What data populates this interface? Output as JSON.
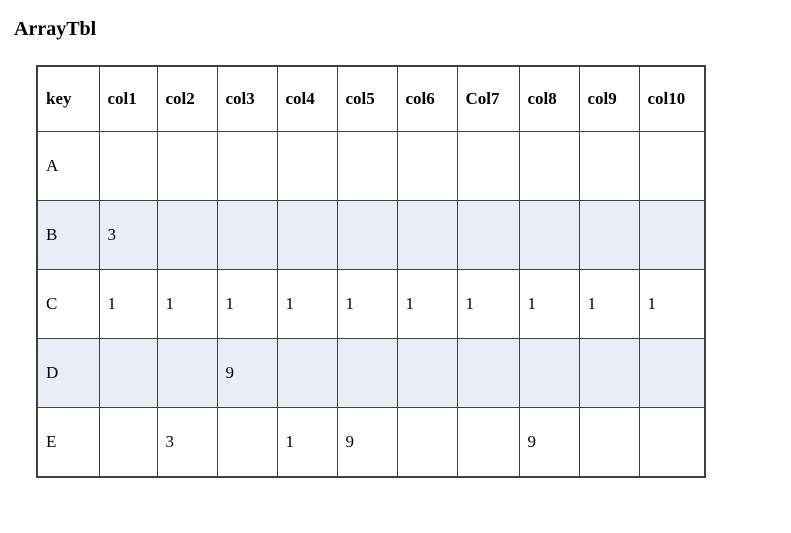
{
  "title": "ArrayTbl",
  "table": {
    "headers": [
      "key",
      "col1",
      "col2",
      "col3",
      "col4",
      "col5",
      "col6",
      "Col7",
      "col8",
      "col9",
      "col10"
    ],
    "rows": [
      {
        "key": "A",
        "cells": [
          "",
          "",
          "",
          "",
          "",
          "",
          "",
          "",
          "",
          ""
        ]
      },
      {
        "key": "B",
        "cells": [
          "3",
          "",
          "",
          "",
          "",
          "",
          "",
          "",
          "",
          ""
        ]
      },
      {
        "key": "C",
        "cells": [
          "1",
          "1",
          "1",
          "1",
          "1",
          "1",
          "1",
          "1",
          "1",
          "1"
        ]
      },
      {
        "key": "D",
        "cells": [
          "",
          "",
          "9",
          "",
          "",
          "",
          "",
          "",
          "",
          ""
        ]
      },
      {
        "key": "E",
        "cells": [
          "",
          "3",
          "",
          "1",
          "9",
          "",
          "",
          "9",
          "",
          ""
        ]
      }
    ]
  }
}
